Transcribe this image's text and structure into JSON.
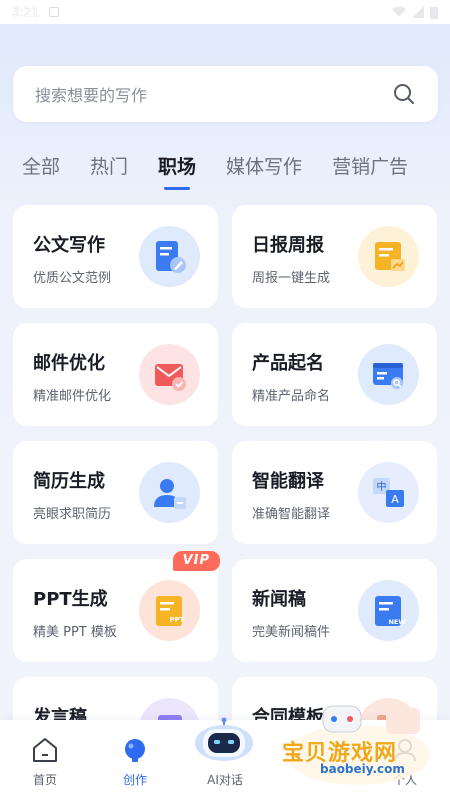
{
  "status": {
    "time": "3:21"
  },
  "search": {
    "placeholder": "搜索想要的写作"
  },
  "tabs": [
    {
      "label": "全部"
    },
    {
      "label": "热门"
    },
    {
      "label": "职场"
    },
    {
      "label": "媒体写作"
    },
    {
      "label": "营销广告"
    }
  ],
  "cards": [
    {
      "title": "公文写作",
      "sub": "优质公文范例",
      "icon": "document-pen-icon",
      "bg": "#dfeafd"
    },
    {
      "title": "日报周报",
      "sub": "周报一键生成",
      "icon": "report-chart-icon",
      "bg": "#fdf1d8"
    },
    {
      "title": "邮件优化",
      "sub": "精准邮件优化",
      "icon": "mail-check-icon",
      "bg": "#fde3e3"
    },
    {
      "title": "产品起名",
      "sub": "精准产品命名",
      "icon": "browser-search-icon",
      "bg": "#dfeafd"
    },
    {
      "title": "简历生成",
      "sub": "亮眼求职简历",
      "icon": "user-card-icon",
      "bg": "#dfeafd"
    },
    {
      "title": "智能翻译",
      "sub": "准确智能翻译",
      "icon": "translate-icon",
      "bg": "#e6edfd"
    },
    {
      "title": "PPT生成",
      "sub": "精美 PPT 模板",
      "icon": "ppt-icon",
      "bg": "#fdf1d8",
      "badge": "VIP"
    },
    {
      "title": "新闻稿",
      "sub": "完美新闻稿件",
      "icon": "news-icon",
      "bg": "#dfeafd"
    },
    {
      "title": "发言稿",
      "sub": "",
      "icon": "speech-icon",
      "bg": "#ece6fd"
    },
    {
      "title": "合同模板",
      "sub": "",
      "icon": "contract-icon",
      "bg": "#fde6de"
    }
  ],
  "nav": [
    {
      "label": "首页",
      "icon": "home-icon"
    },
    {
      "label": "创作",
      "icon": "bulb-icon"
    },
    {
      "label": "AI对话",
      "icon": "robot-icon"
    },
    {
      "label": "",
      "icon": ""
    },
    {
      "label": "个人",
      "icon": "person-icon"
    }
  ],
  "watermark": {
    "text": "宝贝游戏网",
    "url": "baobeiy.com"
  },
  "colors": {
    "accent": "#2f6bf0",
    "vip": "#ff6b5a"
  }
}
